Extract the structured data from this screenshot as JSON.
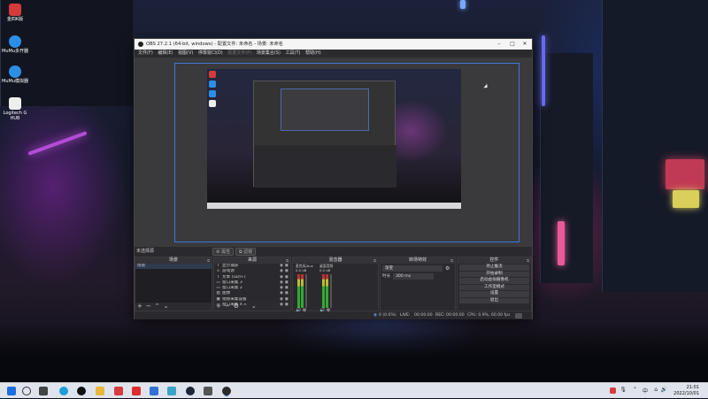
{
  "desktop": {
    "icons": [
      {
        "label": "金四K版",
        "color": "#d63a3a",
        "name": "jinsi-k-icon"
      },
      {
        "label": "MuMu多开器",
        "color": "#2b8fe6",
        "name": "mumu-multi-icon"
      },
      {
        "label": "MuMu模拟器",
        "color": "#2b8fe6",
        "name": "mumu-emulator-icon"
      },
      {
        "label": "Logitech G HUB",
        "color": "#222222",
        "name": "logitech-ghub-icon"
      }
    ]
  },
  "obs": {
    "title": "OBS 27.2.1 (64-bit, windows) - 配置文件: 未命名 - 场景: 未命名",
    "menu": [
      "文件(F)",
      "编辑(E)",
      "视图(V)",
      "停靠窗口(D)",
      "配置文件(P)",
      "场景集合(S)",
      "工具(T)",
      "帮助(H)"
    ],
    "menu_disabled_index": 4,
    "no_source_label": "未选择源",
    "properties_button": "属性",
    "filters_button": "滤镜",
    "docks": {
      "scenes": {
        "title": "场景",
        "items": [
          "场景"
        ]
      },
      "sources": {
        "title": "来源",
        "items": [
          {
            "label": "显示捕获",
            "icon": "T"
          },
          {
            "label": "游戏源",
            "icon": "∞"
          },
          {
            "label": "文本 (GDI+)",
            "icon": "T"
          },
          {
            "label": "窗口采集 3",
            "icon": "▭"
          },
          {
            "label": "窗口采集 2",
            "icon": "▭"
          },
          {
            "label": "图像",
            "icon": "▨"
          },
          {
            "label": "视频采集设备",
            "icon": "▣"
          },
          {
            "label": "窗口采集 4",
            "icon": "▭"
          },
          {
            "label": "窗口采集",
            "icon": "▭"
          }
        ]
      },
      "mixer": {
        "title": "混音器",
        "channels": [
          {
            "name": "麦克风/Aux",
            "level": "0.0 dB"
          },
          {
            "name": "桌面音频",
            "level": "0.0 dB"
          }
        ]
      },
      "transitions": {
        "title": "转场特效",
        "type": "渐变",
        "duration_label": "时长",
        "duration_value": "300 ms"
      },
      "controls": {
        "title": "控件",
        "buttons": [
          "停止推流",
          "开始录制",
          "启动虚拟摄像机",
          "工作室模式",
          "设置",
          "退出"
        ]
      }
    },
    "status": {
      "dropped": "0 (0.0%)",
      "live_label": "LIVE:",
      "live_time": "00:00:00",
      "rec_label": "REC:",
      "rec_time": "00:00:00",
      "cpu": "CPU: 0.9%, 60.00 fps"
    }
  },
  "taskbar": {
    "apps": [
      {
        "name": "start-icon",
        "color": "#1d6fe0"
      },
      {
        "name": "search-icon",
        "color": "#333333"
      },
      {
        "name": "task-view-icon",
        "color": "#444444"
      },
      {
        "name": "edge-browser-icon",
        "color": "#1aa0d8"
      },
      {
        "name": "qq-icon",
        "color": "#111111"
      },
      {
        "name": "file-explorer-icon",
        "color": "#e8b83a"
      },
      {
        "name": "red-app-icon",
        "color": "#d83b3b"
      },
      {
        "name": "netease-music-icon",
        "color": "#e02d2d"
      },
      {
        "name": "blue-app-icon",
        "color": "#2f73d8"
      },
      {
        "name": "app-icon-1",
        "color": "#3aa3c8"
      },
      {
        "name": "steam-icon",
        "color": "#1b2838"
      },
      {
        "name": "app-icon-2",
        "color": "#555555"
      },
      {
        "name": "obs-taskbar-icon",
        "color": "#2b2b2b"
      }
    ],
    "time": "21:01",
    "date": "2022/10/01"
  }
}
